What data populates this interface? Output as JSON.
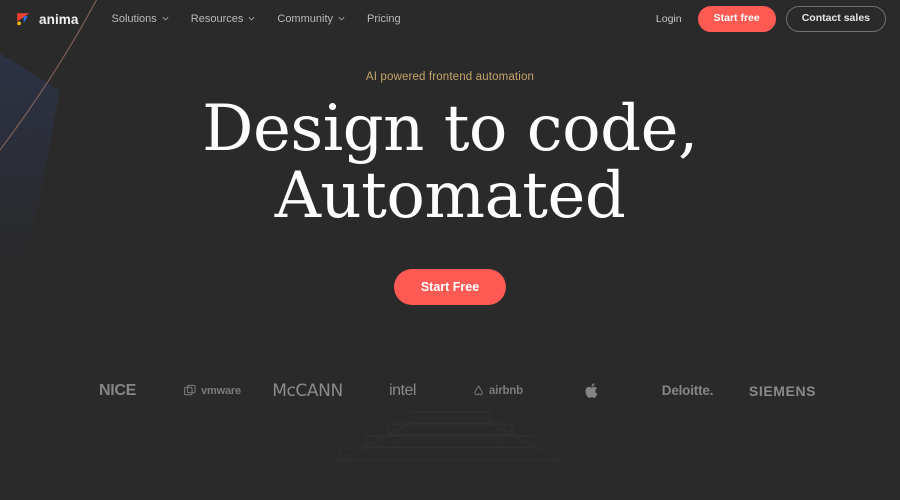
{
  "theme": {
    "background": "#2a2a2a",
    "accent": "#fc5a52",
    "eyebrow_color": "#c6a46a",
    "heading_color": "#fdfdfd",
    "muted_text": "#b9b9b9",
    "logo_grey": "#8a8a8a",
    "corner_blue": "#262b3d",
    "arc_color": "#a4786e"
  },
  "header": {
    "brand": {
      "name": "anima",
      "logo_icon": "anima-logo-icon"
    },
    "nav": [
      {
        "label": "Solutions",
        "has_dropdown": true,
        "icon": "chevron-down-icon"
      },
      {
        "label": "Resources",
        "has_dropdown": true,
        "icon": "chevron-down-icon"
      },
      {
        "label": "Community",
        "has_dropdown": true,
        "icon": "chevron-down-icon"
      },
      {
        "label": "Pricing",
        "has_dropdown": false,
        "icon": ""
      }
    ],
    "login_label": "Login",
    "start_free_label": "Start free",
    "contact_sales_label": "Contact sales"
  },
  "hero": {
    "eyebrow": "AI powered frontend automation",
    "headline_line1": "Design to code,",
    "headline_line2": "Automated",
    "cta_label": "Start Free"
  },
  "logo_strip": [
    {
      "name": "NICE",
      "icon": "",
      "style": "lg-nice"
    },
    {
      "name": "vmware",
      "icon": "vmware-icon",
      "style": "lg-vmware"
    },
    {
      "name": "McCANN",
      "icon": "",
      "style": "lg-mccann"
    },
    {
      "name": "intel",
      "icon": "",
      "style": "lg-intel"
    },
    {
      "name": "airbnb",
      "icon": "airbnb-icon",
      "style": "lg-airbnb"
    },
    {
      "name": "",
      "icon": "apple-icon",
      "style": "lg-apple"
    },
    {
      "name": "Deloitte.",
      "icon": "",
      "style": "lg-deloitte"
    },
    {
      "name": "SIEMENS",
      "icon": "",
      "style": "lg-siemens"
    }
  ]
}
